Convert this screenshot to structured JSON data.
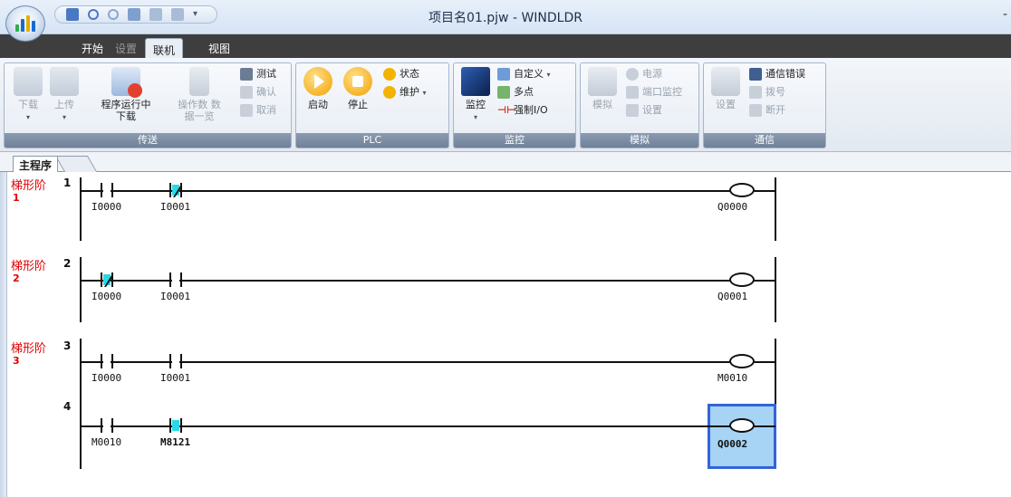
{
  "window": {
    "title": "项目名01.pjw - WINDLDR",
    "minimize": "-"
  },
  "menu_tabs": [
    {
      "label": "开始",
      "state": "normal"
    },
    {
      "label": "设置",
      "state": "disabled"
    },
    {
      "label": "联机",
      "state": "active"
    },
    {
      "label": "视图",
      "state": "normal"
    }
  ],
  "ribbon": {
    "transfer": {
      "label": "传送",
      "download": "下载",
      "upload": "上传",
      "run_download_1": "程序运行中",
      "run_download_2": "下载",
      "op_data_1": "操作数 数",
      "op_data_2": "据一览",
      "test": "测试",
      "confirm": "确认",
      "cancel": "取消"
    },
    "plc": {
      "label": "PLC",
      "start": "启动",
      "stop": "停止",
      "status": "状态",
      "maintain": "维护"
    },
    "monitor": {
      "label": "监控",
      "monitor": "监控",
      "custom": "自定义",
      "multipoint": "多点",
      "force_io": "强制I/O"
    },
    "simulate": {
      "label": "模拟",
      "simulate": "模拟",
      "power": "电源",
      "port_monitor": "端口监控",
      "settings": "设置"
    },
    "comm": {
      "label": "通信",
      "settings": "设置",
      "comm_error": "通信错误",
      "dial": "拨号",
      "disconnect": "断开"
    }
  },
  "doc_tab": "主程序",
  "ladder": {
    "rung_label": "梯形阶",
    "rungs": [
      {
        "num": "1",
        "sub": "1",
        "contacts": [
          {
            "device": "I0000",
            "type": "NO"
          },
          {
            "device": "I0001",
            "type": "NC"
          }
        ],
        "coil": "Q0000"
      },
      {
        "num": "2",
        "sub": "2",
        "contacts": [
          {
            "device": "I0000",
            "type": "NC"
          },
          {
            "device": "I0001",
            "type": "NO"
          }
        ],
        "coil": "Q0001"
      },
      {
        "num": "3",
        "sub": "3",
        "contacts": [
          {
            "device": "I0000",
            "type": "NO"
          },
          {
            "device": "I0001",
            "type": "NO"
          }
        ],
        "coil": "M0010"
      },
      {
        "num": "4",
        "contacts": [
          {
            "device": "M0010",
            "type": "NO"
          },
          {
            "device": "M8121",
            "type": "NO-on"
          }
        ],
        "coil": "Q0002",
        "selected": true
      }
    ]
  },
  "colors": {
    "active_contact": "#2bd9e6",
    "selection_border": "#3363d9",
    "selection_fill": "#a7d3f5",
    "rung_label": "#e00000"
  }
}
